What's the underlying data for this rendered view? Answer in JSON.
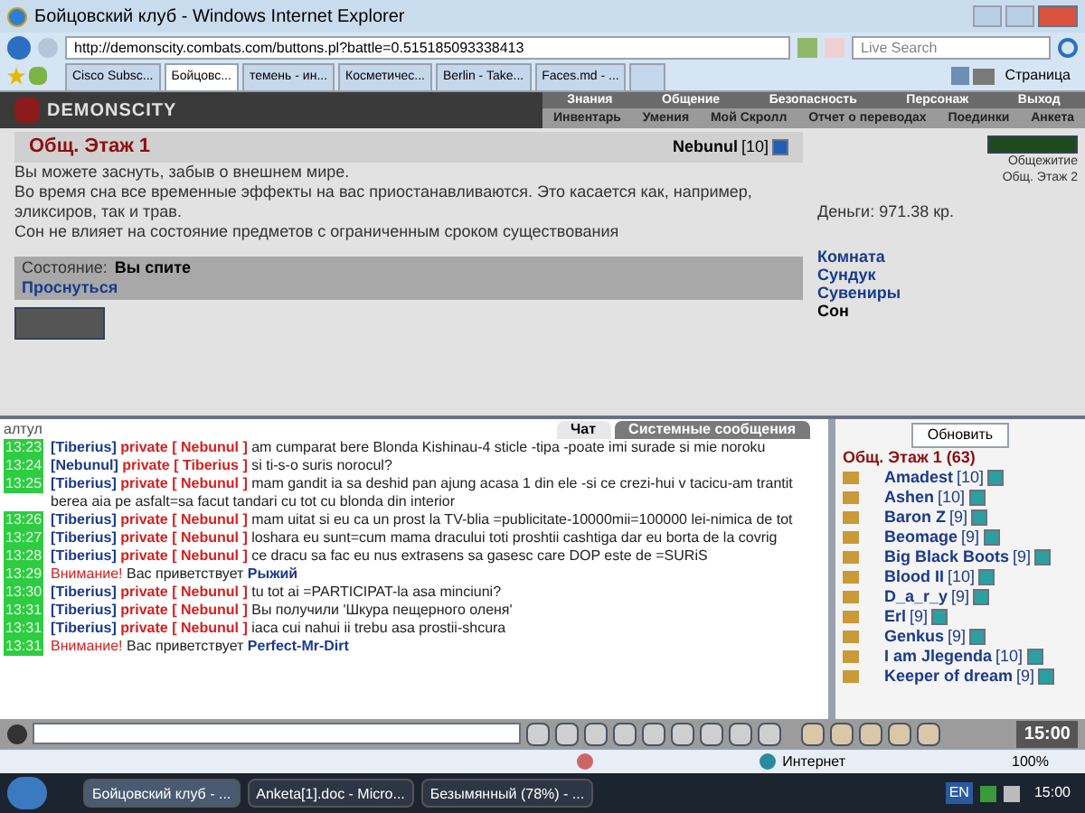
{
  "window": {
    "title": "Бойцовский клуб - Windows Internet Explorer"
  },
  "address_bar": {
    "url": "http://demonscity.combats.com/buttons.pl?battle=0.515185093338413",
    "search_placeholder": "Live Search"
  },
  "browser_tabs": [
    {
      "label": "Cisco Subsc...",
      "selected": false
    },
    {
      "label": "Бойцовс...",
      "selected": true
    },
    {
      "label": "темень - ин...",
      "selected": false
    },
    {
      "label": "Косметичес...",
      "selected": false
    },
    {
      "label": "Berlin - Take...",
      "selected": false
    },
    {
      "label": "Faces.md - ...",
      "selected": false
    }
  ],
  "page_menu": "Страница",
  "game_header": {
    "logo": "DEMONSCITY",
    "top_menu": [
      "Знания",
      "Общение",
      "Безопасность",
      "Персонаж",
      "Выход"
    ],
    "sub_menu": [
      "Инвентарь",
      "Умения",
      "Мой Скролл",
      "Отчет о переводах",
      "Поединки",
      "Анкета"
    ]
  },
  "room": {
    "title": "Общ. Этаж 1",
    "player": "Nebunul",
    "player_level": "[10]",
    "description": [
      "Вы можете заснуть, забыв о внешнем мире.",
      "Во время сна все временные эффекты на вас приостанавливаются. Это касается как, например, эликсиров, так и трав.",
      "Сон не влияет на состояние предметов с ограниченным сроком существования"
    ],
    "status_label": "Состояние:",
    "status_value": "Вы спите",
    "wake_link": "Проснуться"
  },
  "side_panel": {
    "exits": [
      "Общежитие",
      "Общ. Этаж 2"
    ],
    "money": "Деньги: 971.38 кр.",
    "links": [
      {
        "label": "Комната",
        "selected": false
      },
      {
        "label": "Сундук",
        "selected": false
      },
      {
        "label": "Сувениры",
        "selected": false
      },
      {
        "label": "Сон",
        "selected": true
      }
    ]
  },
  "chat_tabs": [
    {
      "label": "Чат",
      "selected": true
    },
    {
      "label": "Системные сообщения",
      "selected": false
    }
  ],
  "chat": [
    {
      "kind": "plain",
      "text": "алтул"
    },
    {
      "kind": "private",
      "time": "13:23",
      "from": "Tiberius",
      "to": "Nebunul",
      "text": "am cumparat bere Blonda Kishinau-4 sticle -tipa -poate imi surade si mie noroku"
    },
    {
      "kind": "private",
      "time": "13:24",
      "from": "Nebunul",
      "to": "Tiberius",
      "text": "si ti-s-o suris norocul?"
    },
    {
      "kind": "private",
      "time": "13:25",
      "from": "Tiberius",
      "to": "Nebunul",
      "text": "mam gandit ia sa deshid pan ajung acasa 1 din ele -si ce crezi-hui v tacicu-am trantit berea aia pe asfalt=sa facut tandari cu tot cu blonda din interior"
    },
    {
      "kind": "private",
      "time": "13:26",
      "from": "Tiberius",
      "to": "Nebunul",
      "text": "mam uitat si eu ca un prost la TV-blia =publicitate-10000mii=100000 lei-nimica de tot"
    },
    {
      "kind": "private",
      "time": "13:27",
      "from": "Tiberius",
      "to": "Nebunul",
      "text": "loshara eu sunt=cum mama dracului toti proshtii cashtiga dar eu borta de la covrig"
    },
    {
      "kind": "private",
      "time": "13:28",
      "from": "Tiberius",
      "to": "Nebunul",
      "text": "ce dracu sa fac eu nus extrasens sa gasesc care DOP este de =SURiS"
    },
    {
      "kind": "system",
      "time": "13:29",
      "label": "Внимание!",
      "text": "Вас приветствует",
      "name": "Рыжий"
    },
    {
      "kind": "private",
      "time": "13:30",
      "from": "Tiberius",
      "to": "Nebunul",
      "text": "tu tot ai =PARTICIPAT-la asa minciuni?"
    },
    {
      "kind": "private",
      "time": "13:31",
      "from": "Tiberius",
      "to": "Nebunul",
      "text": "Вы получили 'Шкура пещерного оленя'"
    },
    {
      "kind": "private",
      "time": "13:31",
      "from": "Tiberius",
      "to": "Nebunul",
      "text": "iaca cui nahui ii trebu asa prostii-shcura"
    },
    {
      "kind": "system",
      "time": "13:31",
      "label": "Внимание!",
      "text": "Вас приветствует",
      "name": "Perfect-Mr-Dirt"
    }
  ],
  "private_label": "private",
  "brackets": {
    "open": "[",
    "close": "]"
  },
  "refresh_button": "Обновить",
  "online": {
    "title": "Общ. Этаж 1 (63)",
    "users": [
      {
        "name": "Amadest",
        "level": "[10]"
      },
      {
        "name": "Ashen",
        "level": "[10]"
      },
      {
        "name": "Baron Z",
        "level": "[9]"
      },
      {
        "name": "Beomage",
        "level": "[9]"
      },
      {
        "name": "Big Black Boots",
        "level": "[9]"
      },
      {
        "name": "Blood II",
        "level": "[10]"
      },
      {
        "name": "D_a_r_y",
        "level": "[9]"
      },
      {
        "name": "Erl",
        "level": "[9]"
      },
      {
        "name": "Genkus",
        "level": "[9]"
      },
      {
        "name": "I am Jlegenda",
        "level": "[10]"
      },
      {
        "name": "Keeper of dream",
        "level": "[9]"
      }
    ]
  },
  "game_clock": "15:00",
  "status_bar": {
    "zone": "Интернет",
    "zoom": "100%"
  },
  "taskbar": {
    "items": [
      {
        "label": "Бойцовский клуб - ...",
        "selected": true
      },
      {
        "label": "Anketa[1].doc - Micro...",
        "selected": false
      },
      {
        "label": "Безымянный (78%) - ...",
        "selected": false
      }
    ],
    "language": "EN",
    "clock": "15:00"
  }
}
